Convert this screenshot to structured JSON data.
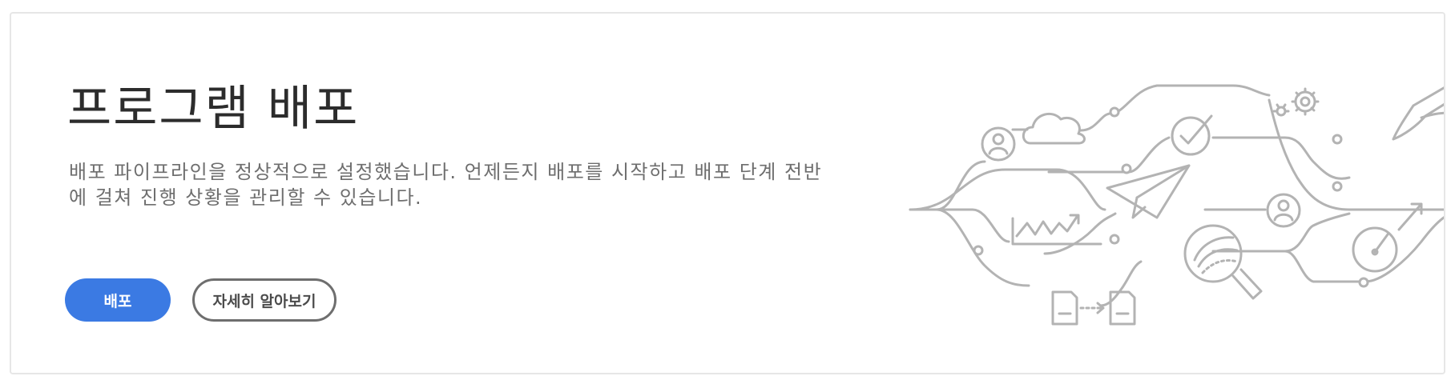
{
  "banner": {
    "title": "프로그램 배포",
    "description": "배포 파이프라인을 정상적으로 설정했습니다. 언제든지 배포를 시작하고 배포 단계 전반에 걸쳐 진행 상황을 관리할 수 있습니다.",
    "primary_button_label": "배포",
    "secondary_button_label": "자세히 알아보기"
  },
  "illustration": {
    "icons": [
      "user-icon",
      "cloud-icon",
      "check-icon",
      "gear-icon",
      "pen-icon",
      "paper-plane-icon",
      "chart-icon",
      "user-icon",
      "speedometer-icon",
      "magnifier-icon",
      "document-icon",
      "document-icon"
    ]
  },
  "colors": {
    "primary": "#3b7ae3",
    "illustration_stroke": "#b3b3b3",
    "title": "#2c2c2c",
    "text": "#6e6e6e"
  }
}
